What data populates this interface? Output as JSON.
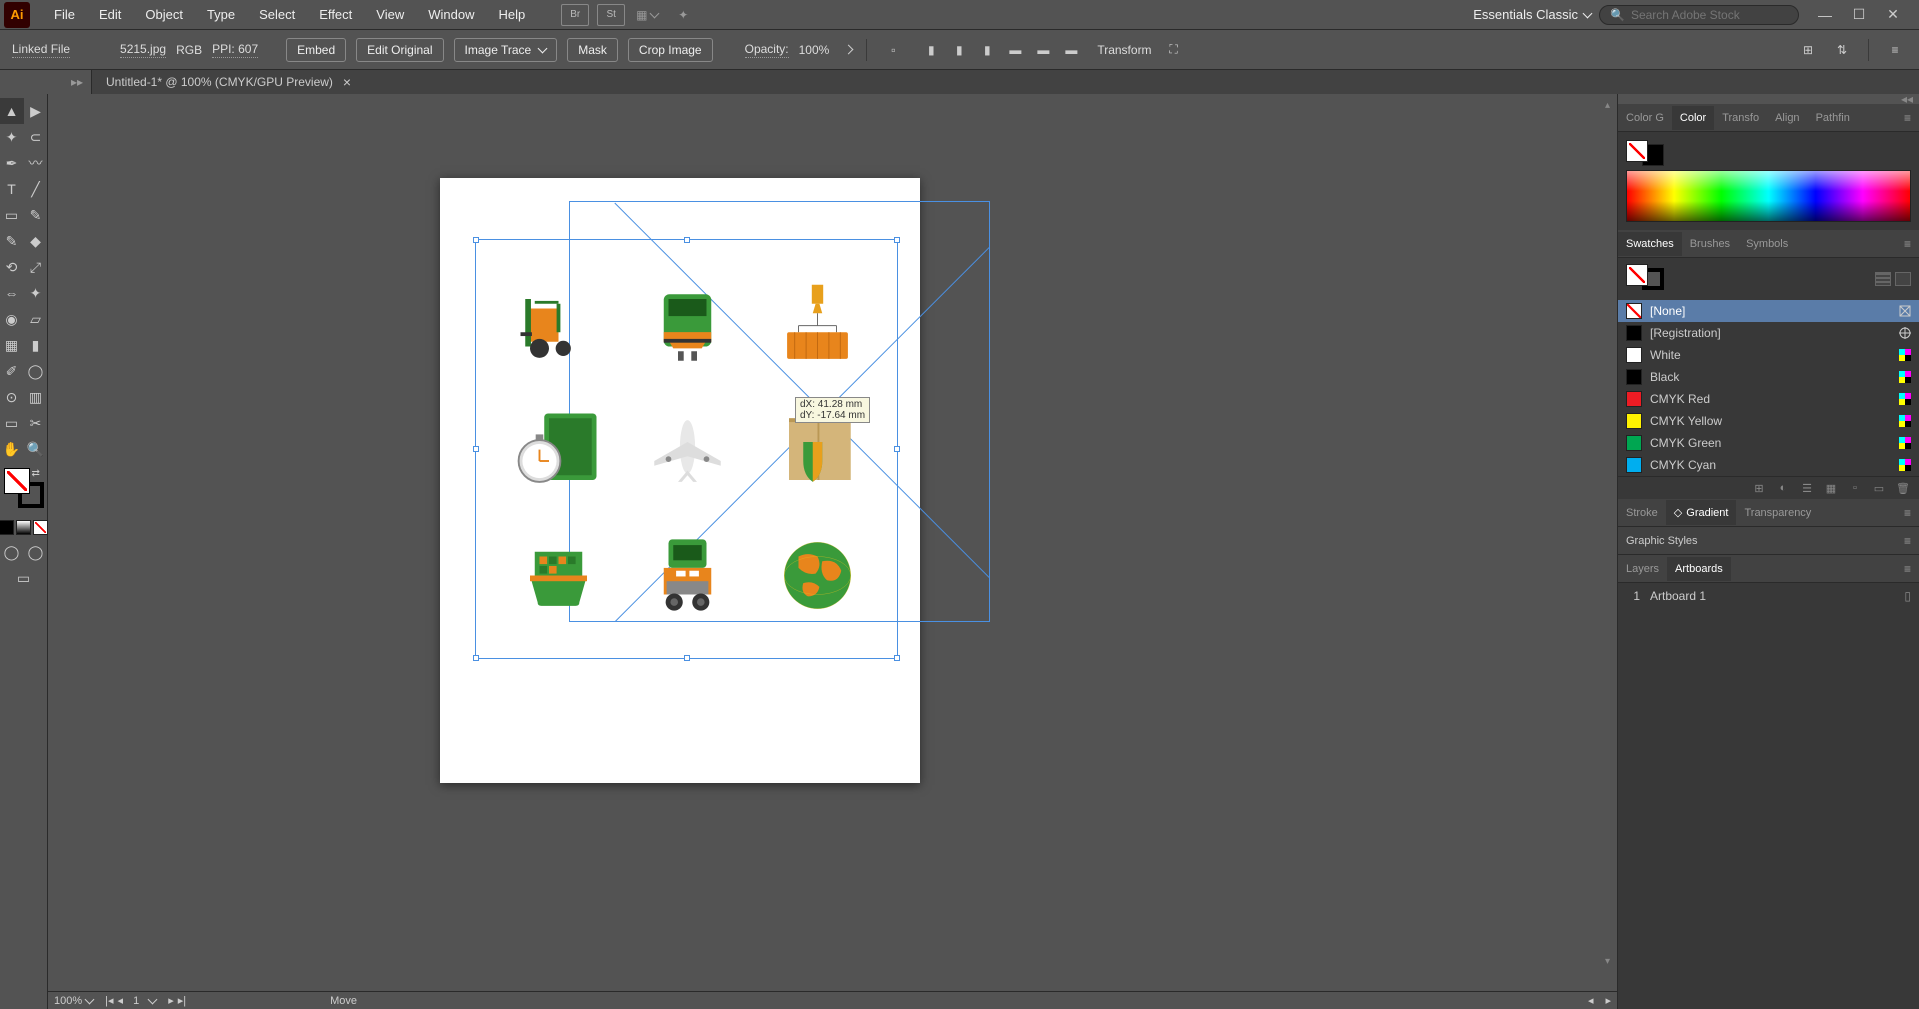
{
  "app_icon": "Ai",
  "menu": [
    "File",
    "Edit",
    "Object",
    "Type",
    "Select",
    "Effect",
    "View",
    "Window",
    "Help"
  ],
  "workspace": "Essentials Classic",
  "search_placeholder": "Search Adobe Stock",
  "control": {
    "linked_file": "Linked File",
    "file_name": "5215.jpg",
    "color_mode": "RGB",
    "ppi_label": "PPI: 607",
    "embed": "Embed",
    "edit_original": "Edit Original",
    "image_trace": "Image Trace",
    "mask": "Mask",
    "crop": "Crop Image",
    "opacity_label": "Opacity:",
    "opacity_value": "100%",
    "transform": "Transform"
  },
  "doc_tab": "Untitled-1* @ 100% (CMYK/GPU Preview)",
  "tooltip": {
    "dx": "dX: 41.28 mm",
    "dy": "dY: -17.64 mm"
  },
  "status": {
    "zoom": "100%",
    "artboard_nav": "1",
    "action": "Move"
  },
  "panels": {
    "color_tabs": [
      "Color G",
      "Color",
      "Transfo",
      "Align",
      "Pathfin"
    ],
    "color_active": 1,
    "swatch_tabs": [
      "Swatches",
      "Brushes",
      "Symbols"
    ],
    "swatch_active": 0,
    "swatches": [
      {
        "name": "[None]",
        "color": "none",
        "selected": true,
        "end": "noshow"
      },
      {
        "name": "[Registration]",
        "color": "#000000",
        "end": "target"
      },
      {
        "name": "White",
        "color": "#ffffff",
        "end": "cmyk"
      },
      {
        "name": "Black",
        "color": "#000000",
        "end": "cmyk"
      },
      {
        "name": "CMYK Red",
        "color": "#ed1c24",
        "end": "cmyk"
      },
      {
        "name": "CMYK Yellow",
        "color": "#fff200",
        "end": "cmyk"
      },
      {
        "name": "CMYK Green",
        "color": "#00a651",
        "end": "cmyk"
      },
      {
        "name": "CMYK Cyan",
        "color": "#00aeef",
        "end": "cmyk"
      }
    ],
    "stroke_tabs": [
      "Stroke",
      "Gradient",
      "Transparency"
    ],
    "stroke_active": 1,
    "graphic_styles": "Graphic Styles",
    "layer_tabs": [
      "Layers",
      "Artboards"
    ],
    "layer_active": 1,
    "artboard_num": "1",
    "artboard_name": "Artboard 1"
  }
}
